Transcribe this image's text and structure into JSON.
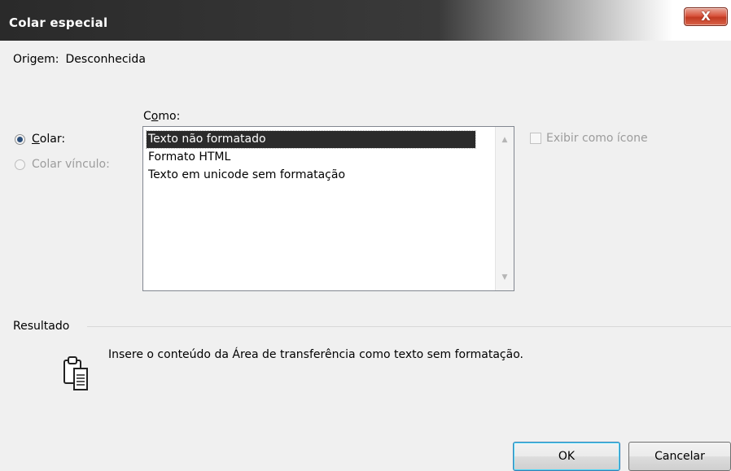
{
  "window": {
    "title": "Colar especial",
    "close_label": "X"
  },
  "origin": {
    "label": "Origem:",
    "value": "Desconhecida"
  },
  "como": {
    "label_before": "C",
    "label_mnemonic": "o",
    "label_after": "mo:"
  },
  "radios": [
    {
      "label_mnemonic": "C",
      "label_rest": "olar:",
      "checked": true,
      "enabled": true
    },
    {
      "label": "Colar vínculo:",
      "checked": false,
      "enabled": false
    }
  ],
  "list": {
    "items": [
      "Texto não formatado",
      "Formato HTML",
      "Texto em unicode sem formatação"
    ],
    "selected_index": 0
  },
  "display_as_icon": {
    "label": "Exibir como ícone",
    "checked": false,
    "enabled": false
  },
  "result": {
    "label": "Resultado",
    "description": "Insere o conteúdo da Área de transferência como texto sem formatação.",
    "icon": "clipboard-icon"
  },
  "buttons": {
    "ok": "OK",
    "cancel": "Cancelar"
  }
}
